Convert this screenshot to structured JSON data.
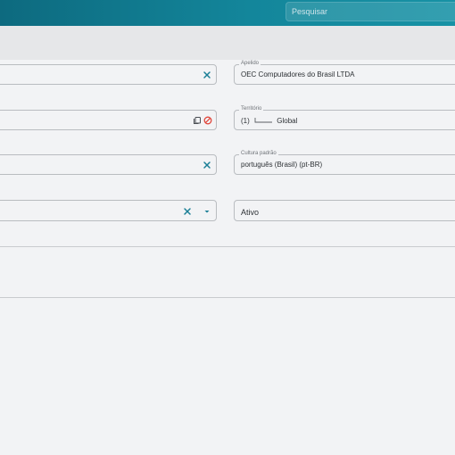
{
  "header": {
    "search_placeholder": "Pesquisar"
  },
  "form": {
    "nickname": {
      "label": "Apelido",
      "value": "OEC Computadores do Brasil LTDA"
    },
    "territory": {
      "label": "Território",
      "prefix": "(1)",
      "value": "Global"
    },
    "culture": {
      "label": "Cultura padrão",
      "value": "português (Brasil) (pt-BR)"
    },
    "status": {
      "value": "Ativo"
    }
  },
  "colors": {
    "accent": "#1a7f96",
    "danger": "#e0453a"
  },
  "icons": {
    "clear": "close-icon",
    "copy": "copy-icon",
    "block": "block-icon",
    "dropdown": "caret-down-icon"
  }
}
